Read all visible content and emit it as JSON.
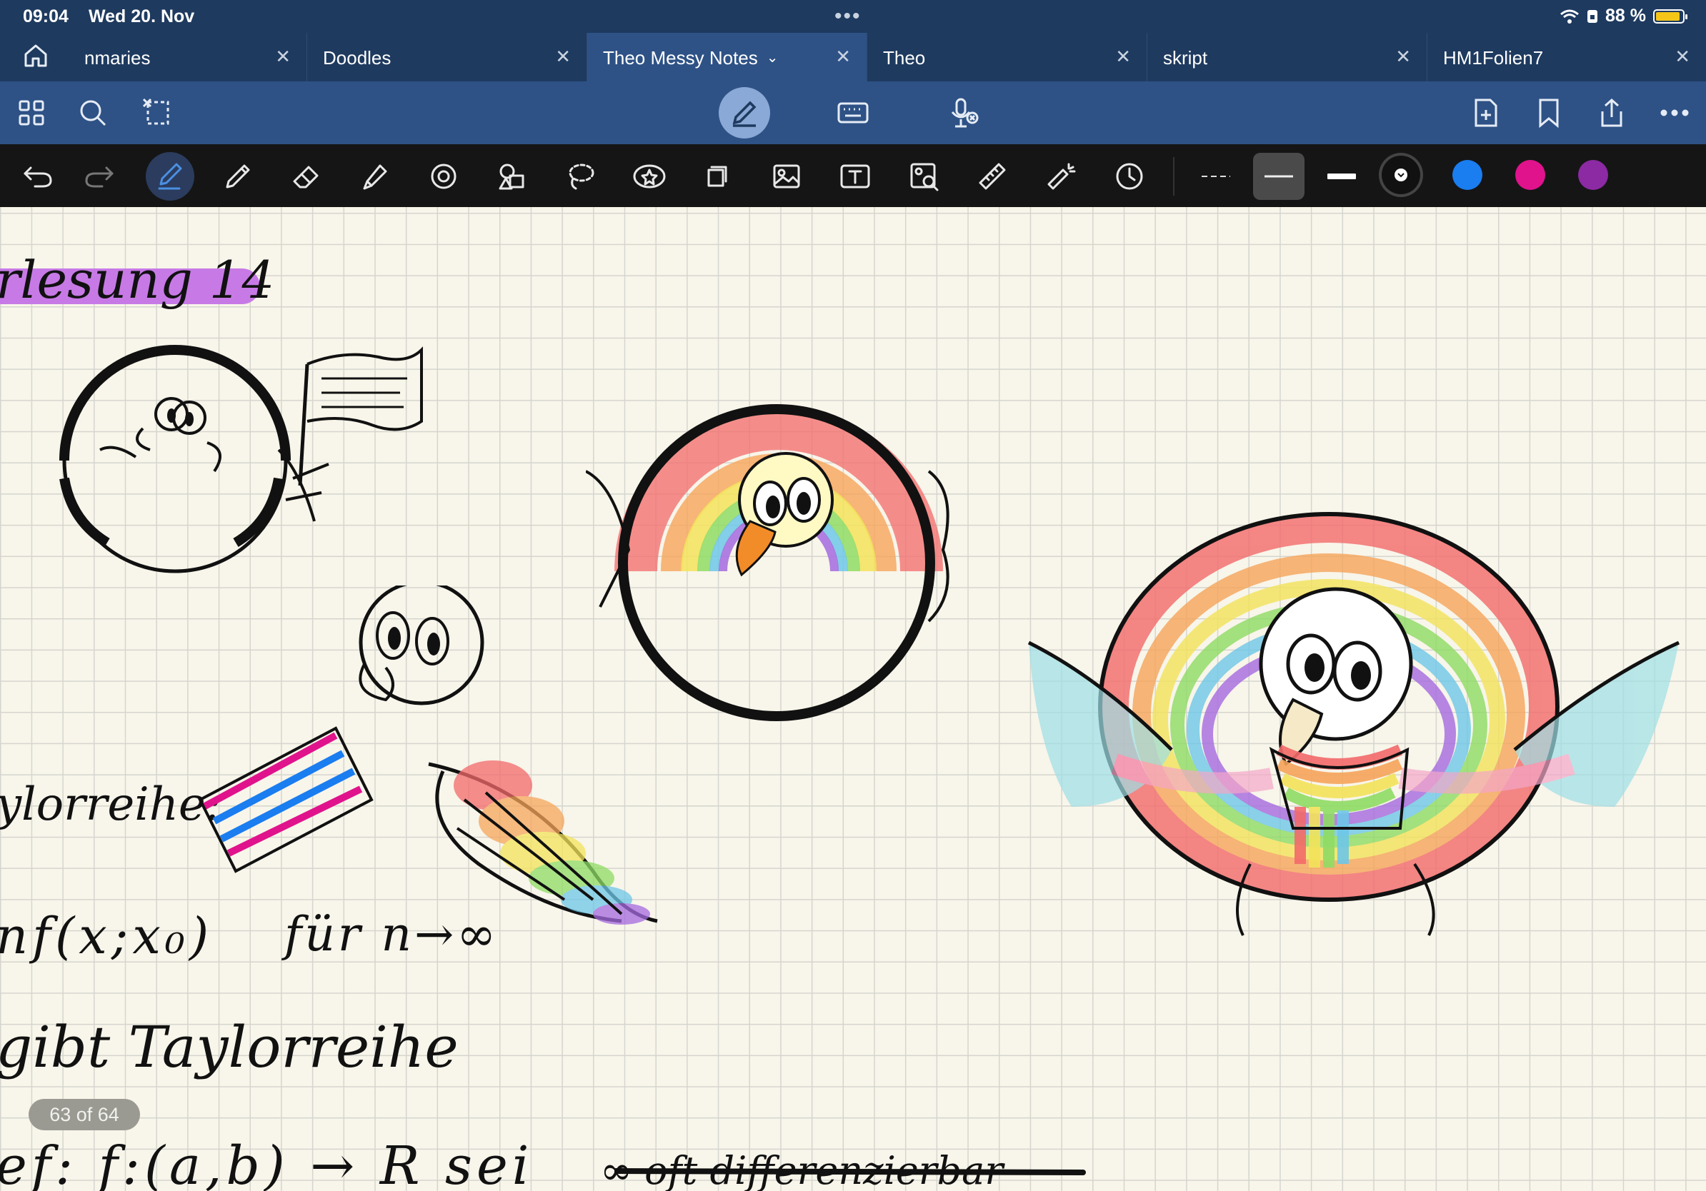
{
  "status_bar": {
    "time": "09:04",
    "date": "Wed 20. Nov",
    "battery": "88 %",
    "battery_level": 0.88
  },
  "tabs": [
    {
      "label": "nmaries",
      "active": false
    },
    {
      "label": "Doodles",
      "active": false
    },
    {
      "label": "Theo Messy Notes",
      "active": true
    },
    {
      "label": "Theo",
      "active": false
    },
    {
      "label": "skript",
      "active": false
    },
    {
      "label": "HM1Folien7",
      "active": false
    }
  ],
  "app_bar": {
    "left_icons": [
      "grid-icon",
      "search-icon",
      "bookmark-lasso-icon"
    ],
    "center_icons": [
      "pen-mode-icon",
      "keyboard-icon",
      "mic-off-icon"
    ],
    "right_icons": [
      "add-page-icon",
      "bookmark-icon",
      "share-icon",
      "more-icon"
    ]
  },
  "toolbar": {
    "tools": [
      "undo-icon",
      "redo-icon",
      "pen-icon",
      "pencil-icon",
      "eraser-icon",
      "highlighter-icon",
      "shape-icon",
      "elements-icon",
      "lasso-icon",
      "sticker-icon",
      "sticky-note-icon",
      "image-icon",
      "text-icon",
      "scan-icon",
      "ruler-icon",
      "laser-icon",
      "history-icon"
    ],
    "selected_tool": "pen-icon",
    "stroke_options": [
      "dashed",
      "medium",
      "thick"
    ],
    "selected_stroke": "medium",
    "colors": [
      "#111111",
      "#1a7df0",
      "#e0138c",
      "#8b2aa3"
    ],
    "selected_color": "#111111"
  },
  "notes": {
    "heading": "rlesung 14",
    "line1": "ylorreihe:",
    "line2": "nf(x;x₀)",
    "line2b": "für n→∞",
    "line3": "gibt Taylorreihe",
    "line4": "ef: f:(a,b) → R sei",
    "line4b": "∞ oft differenzierbar"
  },
  "page_indicator": "63 of 64",
  "colors": {
    "chrome": "#1e3a5f",
    "appbar": "#2e5286",
    "toolbar": "#151515",
    "paper": "#f8f5ea",
    "highlight": "#c77ae6"
  }
}
